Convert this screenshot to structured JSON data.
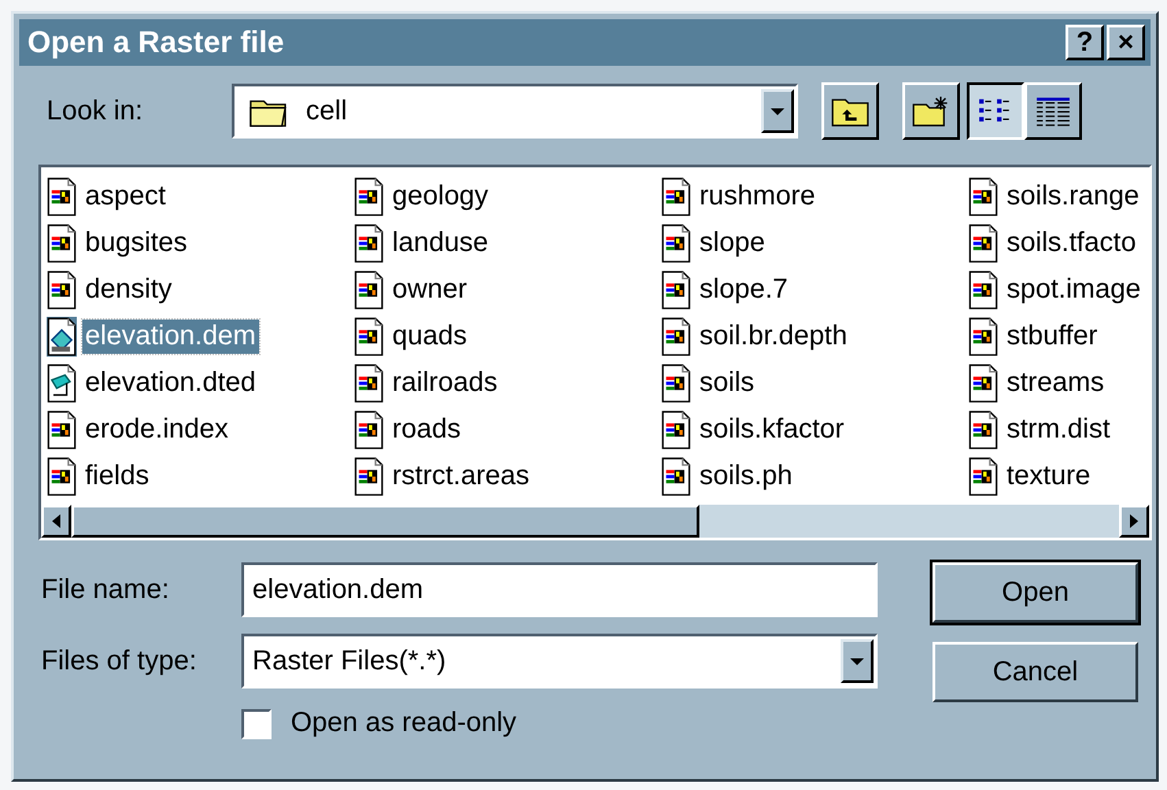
{
  "window": {
    "title": "Open a Raster file",
    "help_button": "?",
    "close_button": "×"
  },
  "look_in": {
    "label": "Look in:",
    "value": "cell"
  },
  "view_buttons": [
    {
      "kind": "list",
      "selected": true
    },
    {
      "kind": "details",
      "selected": false
    }
  ],
  "files": [
    {
      "name": "aspect",
      "kind": "raster",
      "selected": false
    },
    {
      "name": "bugsites",
      "kind": "raster",
      "selected": false
    },
    {
      "name": "density",
      "kind": "raster",
      "selected": false
    },
    {
      "name": "elevation.dem",
      "kind": "dem",
      "selected": true
    },
    {
      "name": "elevation.dted",
      "kind": "dted",
      "selected": false
    },
    {
      "name": "erode.index",
      "kind": "raster",
      "selected": false
    },
    {
      "name": "fields",
      "kind": "raster",
      "selected": false
    },
    {
      "name": "geology",
      "kind": "raster",
      "selected": false
    },
    {
      "name": "landuse",
      "kind": "raster",
      "selected": false
    },
    {
      "name": "owner",
      "kind": "raster",
      "selected": false
    },
    {
      "name": "quads",
      "kind": "raster",
      "selected": false
    },
    {
      "name": "railroads",
      "kind": "raster",
      "selected": false
    },
    {
      "name": "roads",
      "kind": "raster",
      "selected": false
    },
    {
      "name": "rstrct.areas",
      "kind": "raster",
      "selected": false
    },
    {
      "name": "rushmore",
      "kind": "raster",
      "selected": false
    },
    {
      "name": "slope",
      "kind": "raster",
      "selected": false
    },
    {
      "name": "slope.7",
      "kind": "raster",
      "selected": false
    },
    {
      "name": "soil.br.depth",
      "kind": "raster",
      "selected": false
    },
    {
      "name": "soils",
      "kind": "raster",
      "selected": false
    },
    {
      "name": "soils.kfactor",
      "kind": "raster",
      "selected": false
    },
    {
      "name": "soils.ph",
      "kind": "raster",
      "selected": false
    },
    {
      "name": "soils.range",
      "kind": "raster",
      "selected": false
    },
    {
      "name": "soils.tfacto",
      "kind": "raster",
      "selected": false
    },
    {
      "name": "spot.image",
      "kind": "raster",
      "selected": false
    },
    {
      "name": "stbuffer",
      "kind": "raster",
      "selected": false
    },
    {
      "name": "streams",
      "kind": "raster",
      "selected": false
    },
    {
      "name": "strm.dist",
      "kind": "raster",
      "selected": false
    },
    {
      "name": "texture",
      "kind": "raster",
      "selected": false
    }
  ],
  "file_name": {
    "label": "File name:",
    "value": "elevation.dem"
  },
  "file_type": {
    "label": "Files of type:",
    "value": "Raster Files(*.*)"
  },
  "read_only": {
    "label": "Open as read-only",
    "checked": false
  },
  "buttons": [
    {
      "label": "Open",
      "default": true
    },
    {
      "label": "Cancel",
      "default": false
    }
  ]
}
